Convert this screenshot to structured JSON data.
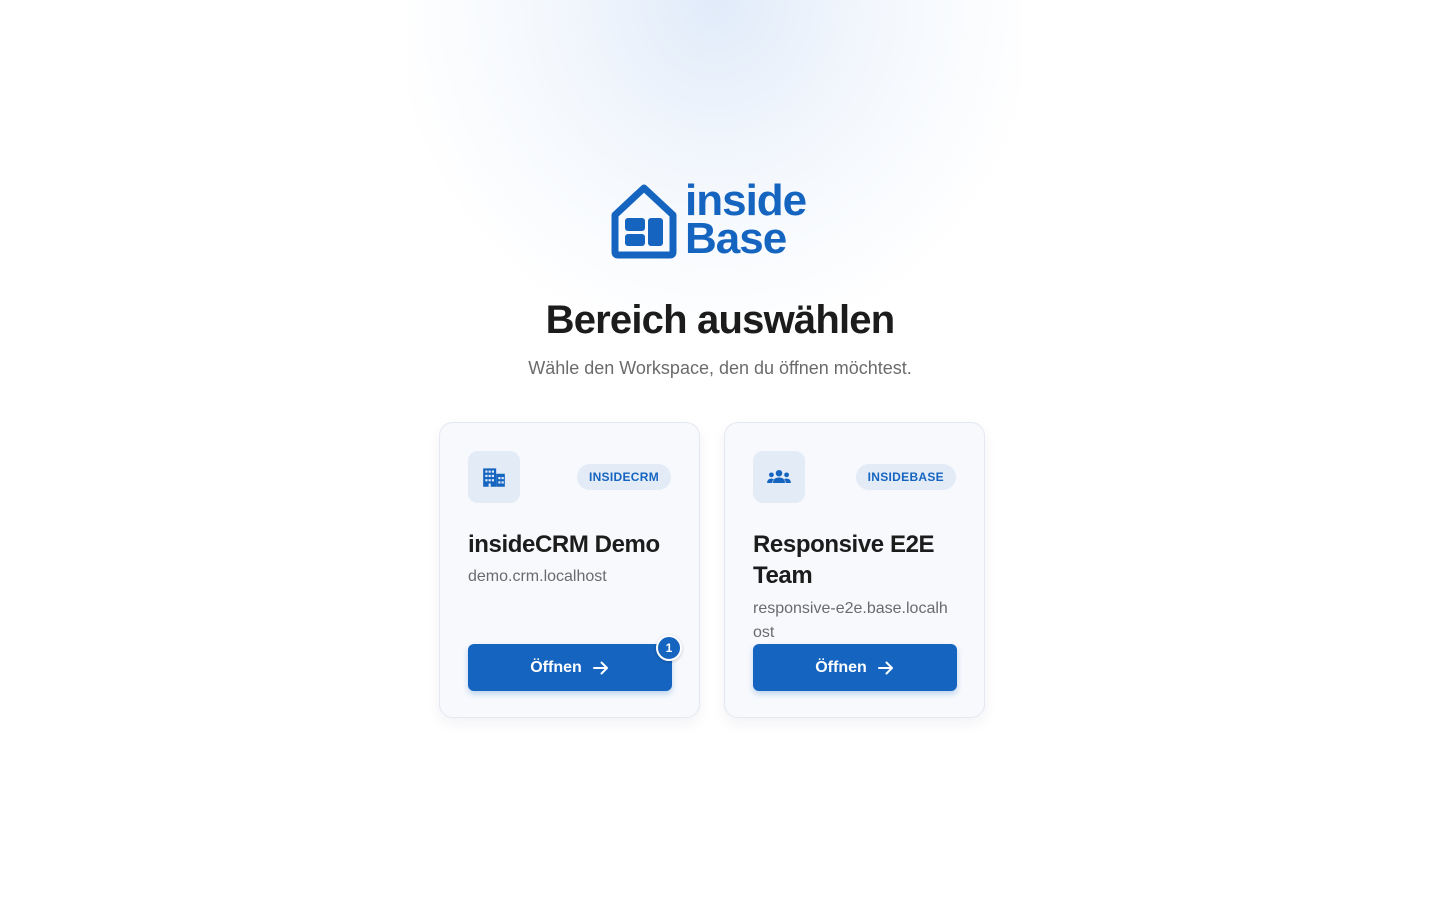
{
  "brand": {
    "line1": "inside",
    "line2": "Base",
    "color": "#1565c0"
  },
  "heading": {
    "title": "Bereich auswählen",
    "subtitle": "Wähle den Workspace, den du öffnen möchtest."
  },
  "workspaces": [
    {
      "icon": "building-icon",
      "badge": "INSIDECRM",
      "name": "insideCRM Demo",
      "host": "demo.crm.localhost",
      "button_label": "Öffnen",
      "notification_count": "1"
    },
    {
      "icon": "team-icon",
      "badge": "INSIDEBASE",
      "name": "Responsive E2E Team",
      "host": "responsive-e2e.base.localhost",
      "button_label": "Öffnen"
    }
  ],
  "colors": {
    "accent": "#1565c0",
    "card_background": "#f7f9fd",
    "badge_background": "#e3ebf6"
  }
}
